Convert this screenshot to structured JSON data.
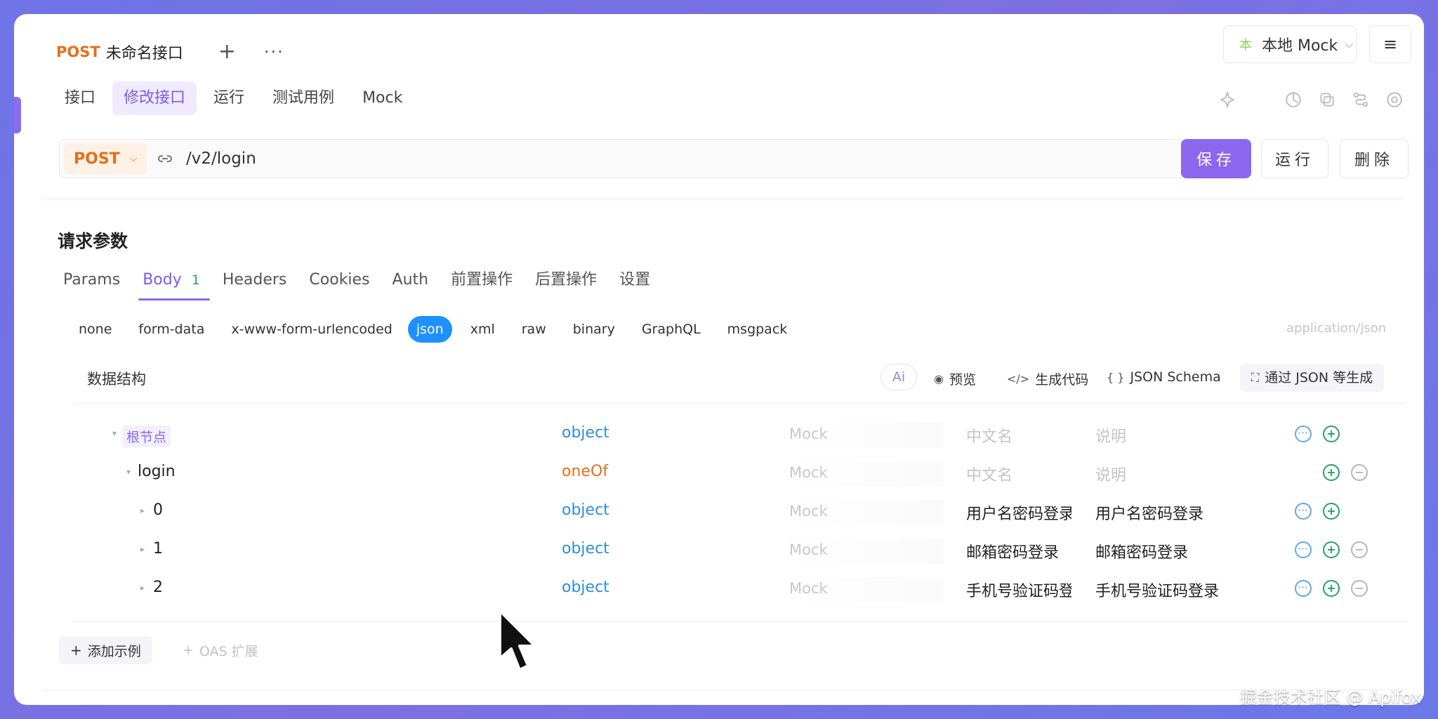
{
  "header": {
    "method": "POST",
    "title": "未命名接口",
    "plus": "+",
    "more": "···",
    "env_icon": "本",
    "env": "本地 Mock",
    "env_chevron": "⌵",
    "menu_icon": "≡"
  },
  "tabs": [
    {
      "label": "接口"
    },
    {
      "label": "修改接口",
      "active": true
    },
    {
      "label": "运行"
    },
    {
      "label": "测试用例"
    },
    {
      "label": "Mock"
    }
  ],
  "urlbar": {
    "method": "POST",
    "path": "/v2/login"
  },
  "actions": {
    "save": "保存",
    "run": "运行",
    "delete": "删除"
  },
  "request": {
    "title": "请求参数",
    "tabs": [
      {
        "label": "Params"
      },
      {
        "label": "Body",
        "count": "1",
        "active": true
      },
      {
        "label": "Headers"
      },
      {
        "label": "Cookies"
      },
      {
        "label": "Auth"
      },
      {
        "label": "前置操作"
      },
      {
        "label": "后置操作"
      },
      {
        "label": "设置"
      }
    ],
    "body_types": [
      "none",
      "form-data",
      "x-www-form-urlencoded",
      "json",
      "xml",
      "raw",
      "binary",
      "GraphQL",
      "msgpack"
    ],
    "active_body_type": "json",
    "content_type": "application/json"
  },
  "structure": {
    "title": "数据结构",
    "ai": "Ai",
    "preview": "预览",
    "gen_code": "生成代码",
    "json_schema": "JSON Schema",
    "gen_from_json": "通过 JSON 等生成"
  },
  "tree": [
    {
      "name": "根节点",
      "type": "object",
      "mock": "Mock",
      "cn": "中文名",
      "desc": "说明",
      "cn_placeholder": true,
      "desc_placeholder": true,
      "actions": [
        "more",
        "add"
      ]
    },
    {
      "name": "login",
      "type": "oneOf",
      "mock": "Mock",
      "cn": "中文名",
      "desc": "说明",
      "cn_placeholder": true,
      "desc_placeholder": true,
      "actions": [
        "blank",
        "add",
        "del"
      ]
    },
    {
      "name": "0",
      "type": "object",
      "mock": "Mock",
      "cn": "用户名密码登录",
      "desc": "用户名密码登录",
      "actions": [
        "more",
        "add"
      ]
    },
    {
      "name": "1",
      "type": "object",
      "mock": "Mock",
      "cn": "邮箱密码登录",
      "desc": "邮箱密码登录",
      "actions": [
        "more",
        "add",
        "del"
      ]
    },
    {
      "name": "2",
      "type": "object",
      "mock": "Mock",
      "cn": "手机号验证码登录",
      "desc": "手机号验证码登录",
      "actions": [
        "more",
        "add",
        "del"
      ]
    }
  ],
  "footer": {
    "add_example": "添加示例",
    "oas": "OAS 扩展"
  },
  "watermark": "掘金技术社区 @ Apifox"
}
